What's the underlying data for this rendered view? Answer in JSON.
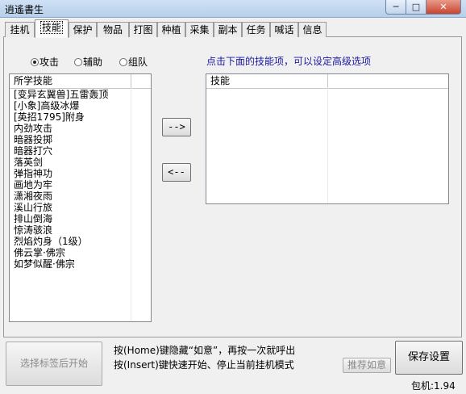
{
  "window": {
    "title": "逍遙書生",
    "min": "─",
    "max": "□",
    "close": "✕"
  },
  "tabs": [
    "挂机",
    "技能",
    "保护",
    "物品",
    "打图",
    "种植",
    "采集",
    "副本",
    "任务",
    "喊话",
    "信息"
  ],
  "active_tab": 1,
  "mode": {
    "options": [
      "攻击",
      "辅助",
      "组队"
    ],
    "selected": 0
  },
  "hint": "点击下面的技能项，可以设定高级选项",
  "learned_list": {
    "header": "所学技能",
    "items": [
      "[变异玄翼兽]五雷轰顶",
      "[小象]高级冰爆",
      "[英招1795]附身",
      "内劲攻击",
      "暗器投掷",
      "暗器打穴",
      "落英剑",
      "弹指神功",
      "画地为牢",
      "潇湘夜雨",
      "溪山行旅",
      "排山倒海",
      "惊涛骇浪",
      "烈焰灼身（1级）",
      "佛云掌·佛宗",
      "如梦似醒·佛宗"
    ]
  },
  "skill_list": {
    "header": "技能",
    "items": []
  },
  "buttons": {
    "add": "-->",
    "remove": "<--",
    "start": "选择标签后开始",
    "recommend": "推荐如意",
    "save": "保存设置"
  },
  "info": {
    "line1": "按(Home)键隐藏“如意”，再按一次就呼出",
    "line2": "按(Insert)键快速开始、停止当前挂机模式"
  },
  "status": "包机:1.94"
}
